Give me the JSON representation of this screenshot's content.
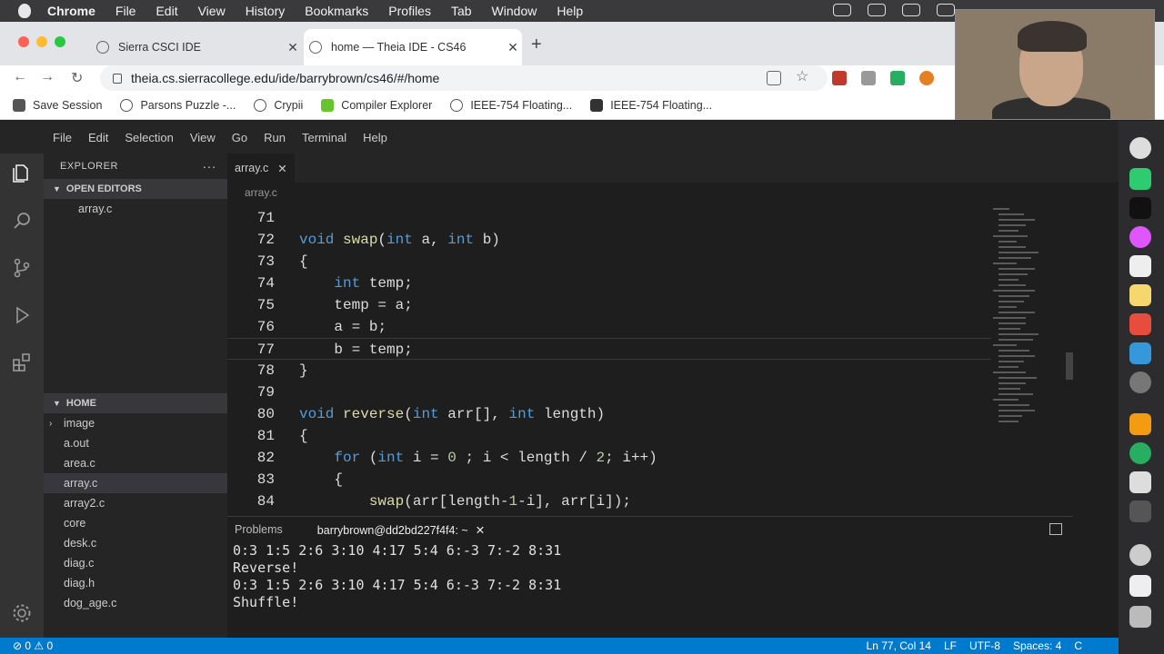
{
  "mac_menu": [
    "Chrome",
    "File",
    "Edit",
    "View",
    "History",
    "Bookmarks",
    "Profiles",
    "Tab",
    "Window",
    "Help"
  ],
  "browser": {
    "tabs": [
      {
        "title": "Sierra CSCI IDE"
      },
      {
        "title": "home — Theia IDE - CS46"
      }
    ],
    "url": "theia.cs.sierracollege.edu/ide/barrybrown/cs46/#/home",
    "bookmarks": [
      "Save Session",
      "Parsons Puzzle -...",
      "Crypii",
      "Compiler Explorer",
      "IEEE-754 Floating...",
      "IEEE-754 Floating..."
    ]
  },
  "ide": {
    "menu": [
      "File",
      "Edit",
      "Selection",
      "View",
      "Go",
      "Run",
      "Terminal",
      "Help"
    ],
    "explorer": {
      "title": "EXPLORER",
      "open_editors_label": "OPEN EDITORS",
      "open_editor_file": "array.c",
      "home_label": "HOME",
      "files": [
        "image",
        "a.out",
        "area.c",
        "array.c",
        "array2.c",
        "core",
        "desk.c",
        "diag.c",
        "diag.h",
        "dog_age.c"
      ]
    },
    "editor_tab": "array.c",
    "breadcrumb": "array.c",
    "code_lines": [
      {
        "num": "71",
        "text": ""
      },
      {
        "num": "72",
        "text": "void swap(int a, int b)"
      },
      {
        "num": "73",
        "text": "{"
      },
      {
        "num": "74",
        "text": "    int temp;"
      },
      {
        "num": "75",
        "text": "    temp = a;"
      },
      {
        "num": "76",
        "text": "    a = b;"
      },
      {
        "num": "77",
        "text": "    b = temp;"
      },
      {
        "num": "78",
        "text": "}"
      },
      {
        "num": "79",
        "text": ""
      },
      {
        "num": "80",
        "text": "void reverse(int arr[], int length)"
      },
      {
        "num": "81",
        "text": "{"
      },
      {
        "num": "82",
        "text": "    for (int i = 0 ; i < length / 2; i++)"
      },
      {
        "num": "83",
        "text": "    {"
      },
      {
        "num": "84",
        "text": "        swap(arr[length-1-i], arr[i]);"
      }
    ],
    "panel": {
      "tabs": [
        "Problems",
        "barrybrown@dd2bd227f4f4: ~"
      ],
      "terminal_lines": [
        "0:3 1:5 2:6 3:10 4:17 5:4 6:-3 7:-2 8:31",
        "Reverse!",
        "0:3 1:5 2:6 3:10 4:17 5:4 6:-3 7:-2 8:31",
        "Shuffle!"
      ]
    },
    "status": {
      "problems": "⊘ 0 ⚠ 0",
      "position": "Ln 77, Col 14",
      "eol": "LF",
      "encoding": "UTF-8",
      "indent": "Spaces: 4",
      "lang": "C"
    }
  }
}
